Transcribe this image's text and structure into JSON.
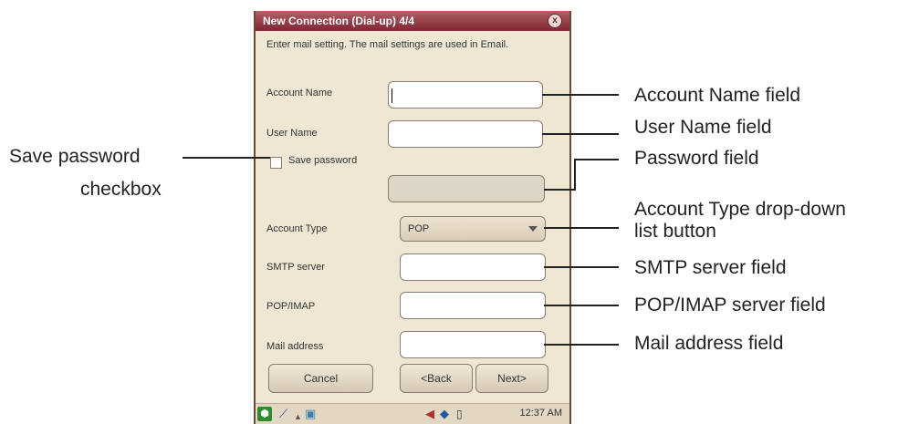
{
  "dialog": {
    "title": "New Connection (Dial-up) 4/4",
    "close_glyph": "x",
    "intro": "Enter mail setting. The mail settings are used in Email."
  },
  "form": {
    "account_name_label": "Account Name",
    "user_name_label": "User Name",
    "save_password_label": "Save password",
    "account_type_label": "Account Type",
    "account_type_value": "POP",
    "smtp_label": "SMTP server",
    "pop_label": "POP/IMAP",
    "mail_label": "Mail address"
  },
  "buttons": {
    "cancel": "Cancel",
    "back": "<Back",
    "next": "Next>"
  },
  "status": {
    "time": "12:37 AM"
  },
  "callouts": {
    "account_name": "Account Name field",
    "user_name": "User Name field",
    "password": "Password field",
    "account_type_1": "Account Type drop-down",
    "account_type_2": "list button",
    "smtp": "SMTP server field",
    "pop": "POP/IMAP server field",
    "mail": "Mail address field",
    "save_password_1": "Save password",
    "save_password_2": "checkbox"
  },
  "colors": {
    "titlebar": "#8a2f3a",
    "panel": "#efe6d4",
    "accent_green": "#2e8b2e"
  },
  "icons": [
    "close-icon",
    "start-icon",
    "signal-icon",
    "folder-icon",
    "speaker-icon",
    "network-icon",
    "battery-icon"
  ]
}
